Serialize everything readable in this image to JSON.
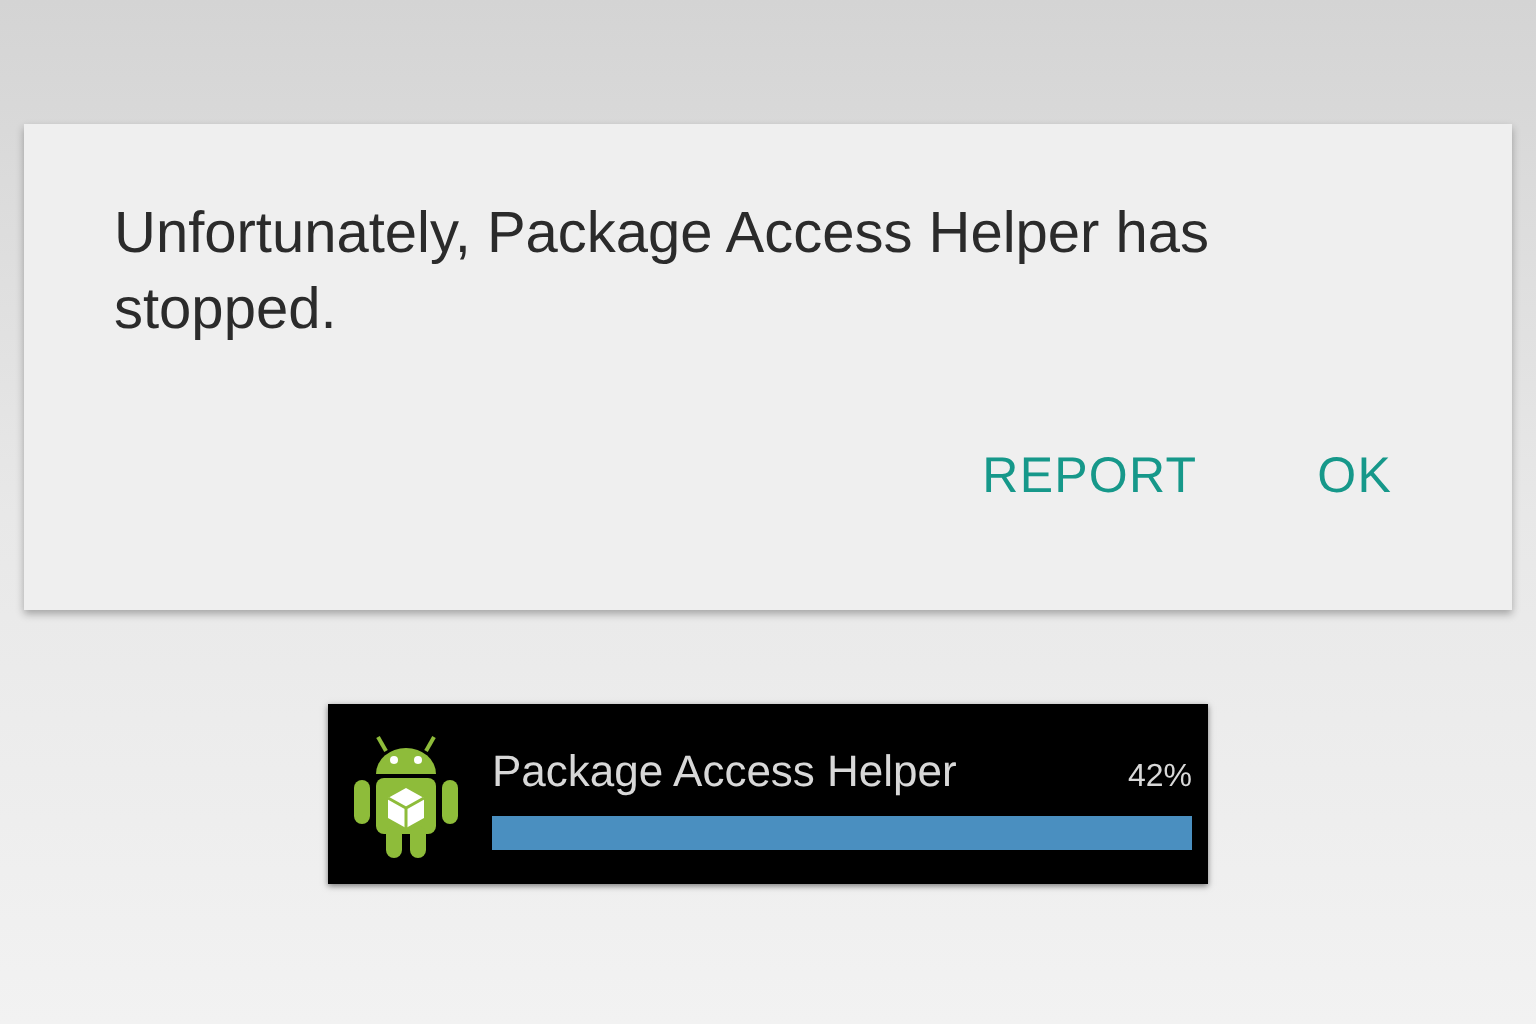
{
  "dialog": {
    "message": "Unfortunately, Package Access Helper has stopped.",
    "buttons": [
      "REPORT",
      "OK"
    ]
  },
  "notification": {
    "title": "Package Access Helper",
    "percent": "42%"
  }
}
